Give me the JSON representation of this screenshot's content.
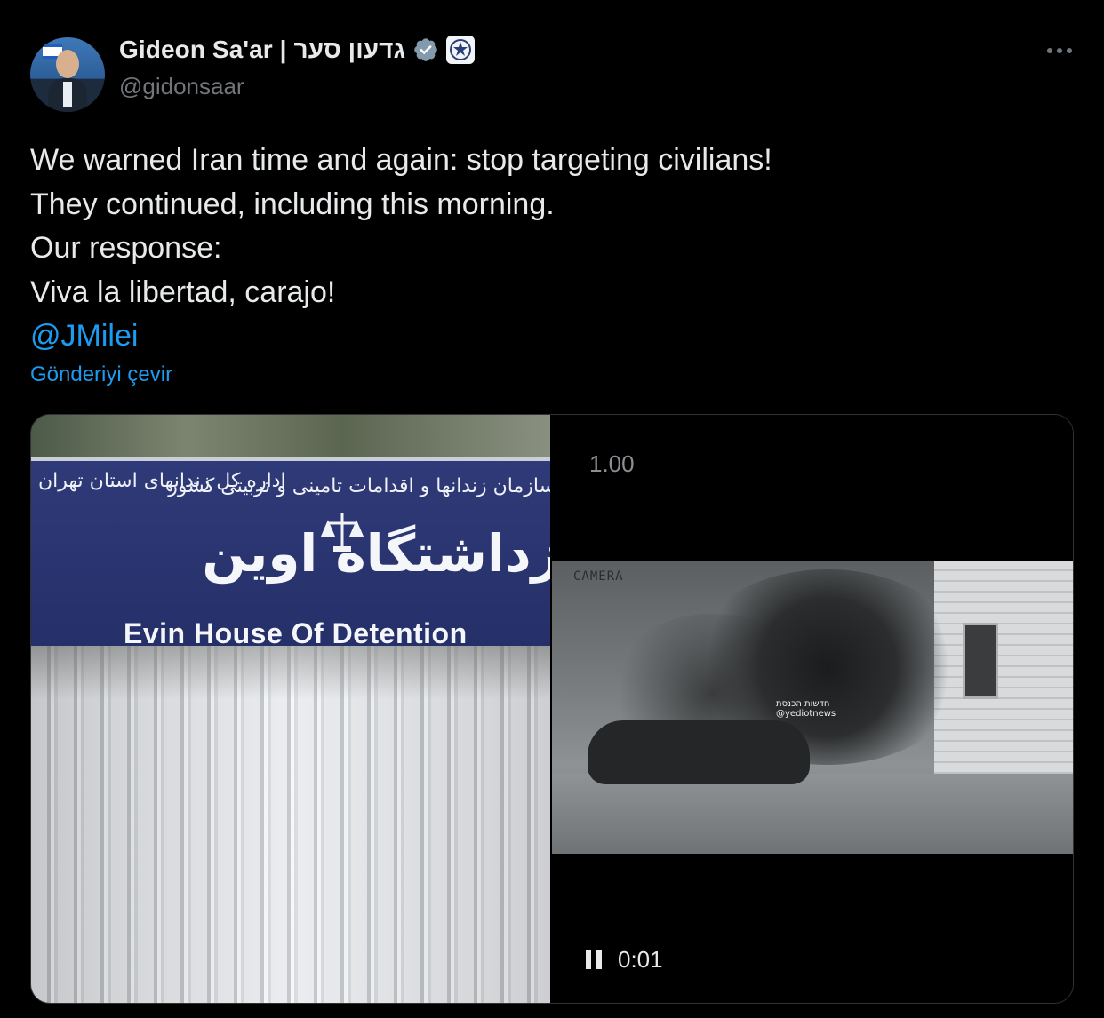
{
  "author": {
    "name": "Gideon Sa'ar | גדעון סער",
    "handle": "@gidonsaar"
  },
  "icons": {
    "verified": "verified-badge-icon",
    "affiliation": "government-affiliation-icon",
    "more": "more-options-icon"
  },
  "tweet": {
    "lines": [
      "We warned Iran time and again: stop targeting civilians!",
      "They continued, including this morning.",
      "Our response:",
      "Viva la libertad, carajo!"
    ],
    "mention": "@JMilei",
    "translate_label": "Gönderiyi çevir"
  },
  "media": {
    "image": {
      "sign_text_fa": "زداشتگاه اوین",
      "sign_small_left": "اداره کل زندانهای استان تهران",
      "sign_small_right": "سازمان زندانها و اقدامات تامینی و تربیتی کشور",
      "sign_text_en": "Evin House Of Detention"
    },
    "video": {
      "playback_rate": "1.00",
      "camera_label": "CAMERA",
      "watermark": "חדשות הכנסת",
      "watermark_sub": "@yediotnews",
      "time": "0:01"
    }
  },
  "colors": {
    "background": "#000000",
    "text": "#e7e9ea",
    "secondary_text": "#71767b",
    "link": "#1d9bf0",
    "verified": "#829aab"
  }
}
